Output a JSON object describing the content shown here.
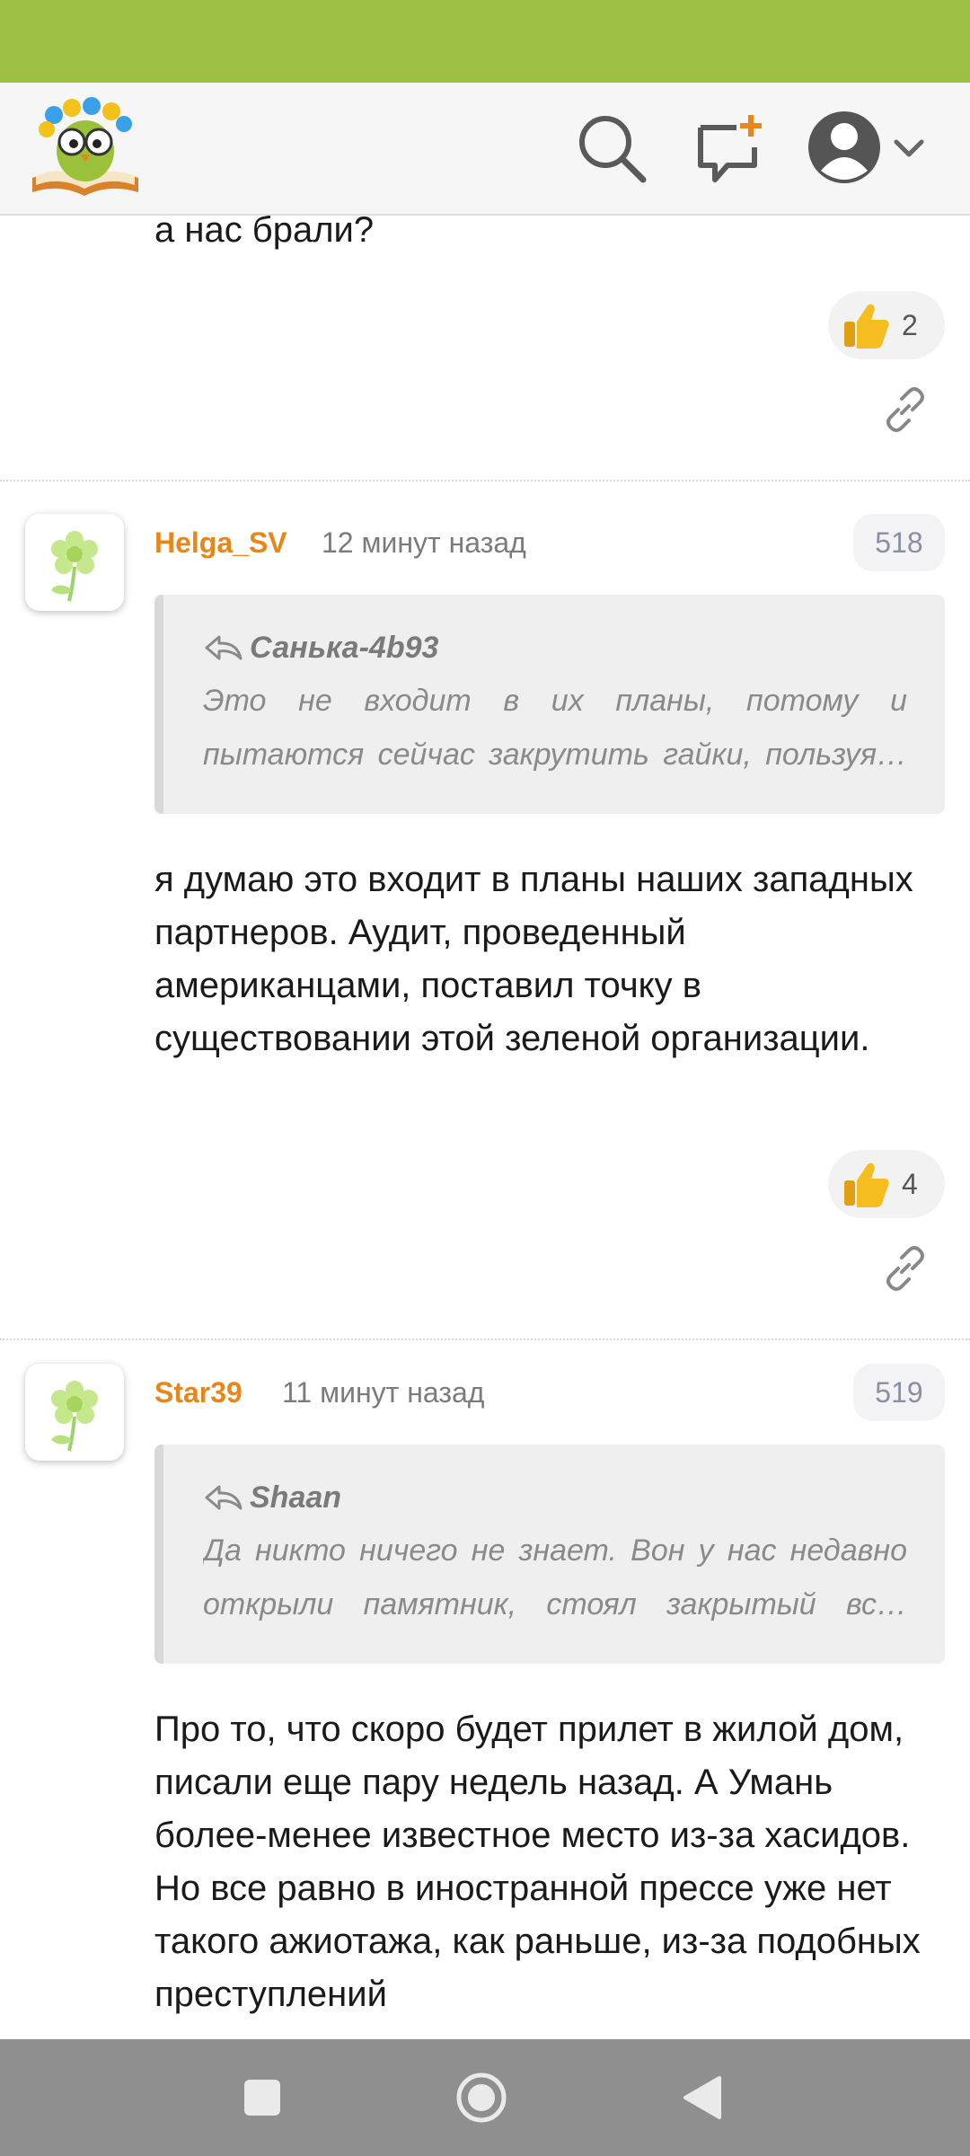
{
  "header": {
    "logo_icon": "owl-reading-book-logo",
    "search_icon": "search-icon",
    "new_post_icon": "chat-plus-icon",
    "profile_icon": "user-avatar-icon"
  },
  "previous_comment": {
    "tail_text": "а нас брали?",
    "likes": "2"
  },
  "comments": [
    {
      "username": "Helga_SV",
      "time": "12 минут назад",
      "number": "518",
      "quote_author": "Санька-4b93",
      "quote_text": "Это не входит в их планы, потому и пытаются сейчас закрутить гайки, пользуя…",
      "text": "я думаю это входит в планы наших западных партнеров. Аудит, проведенный американцами, поставил точку в существовании этой зеленой организации.",
      "likes": "4"
    },
    {
      "username": "Star39",
      "time": "11 минут назад",
      "number": "519",
      "quote_author": "Shaan",
      "quote_text": "Да никто ничего не знает. Вон у нас недавно открыли памятник, стоял закрытый вс…",
      "text": "Про то, что скоро будет прилет в жилой дом, писали еще пару недель назад. А Умань более-менее известное место из-за хасидов. Но все равно в иностранной прессе уже нет такого ажиотажа, как раньше, из-за подобных преступлений"
    }
  ],
  "colors": {
    "status_bar": "#9fc143",
    "username": "#e8861a",
    "nav_bar": "#8f8f8f"
  }
}
